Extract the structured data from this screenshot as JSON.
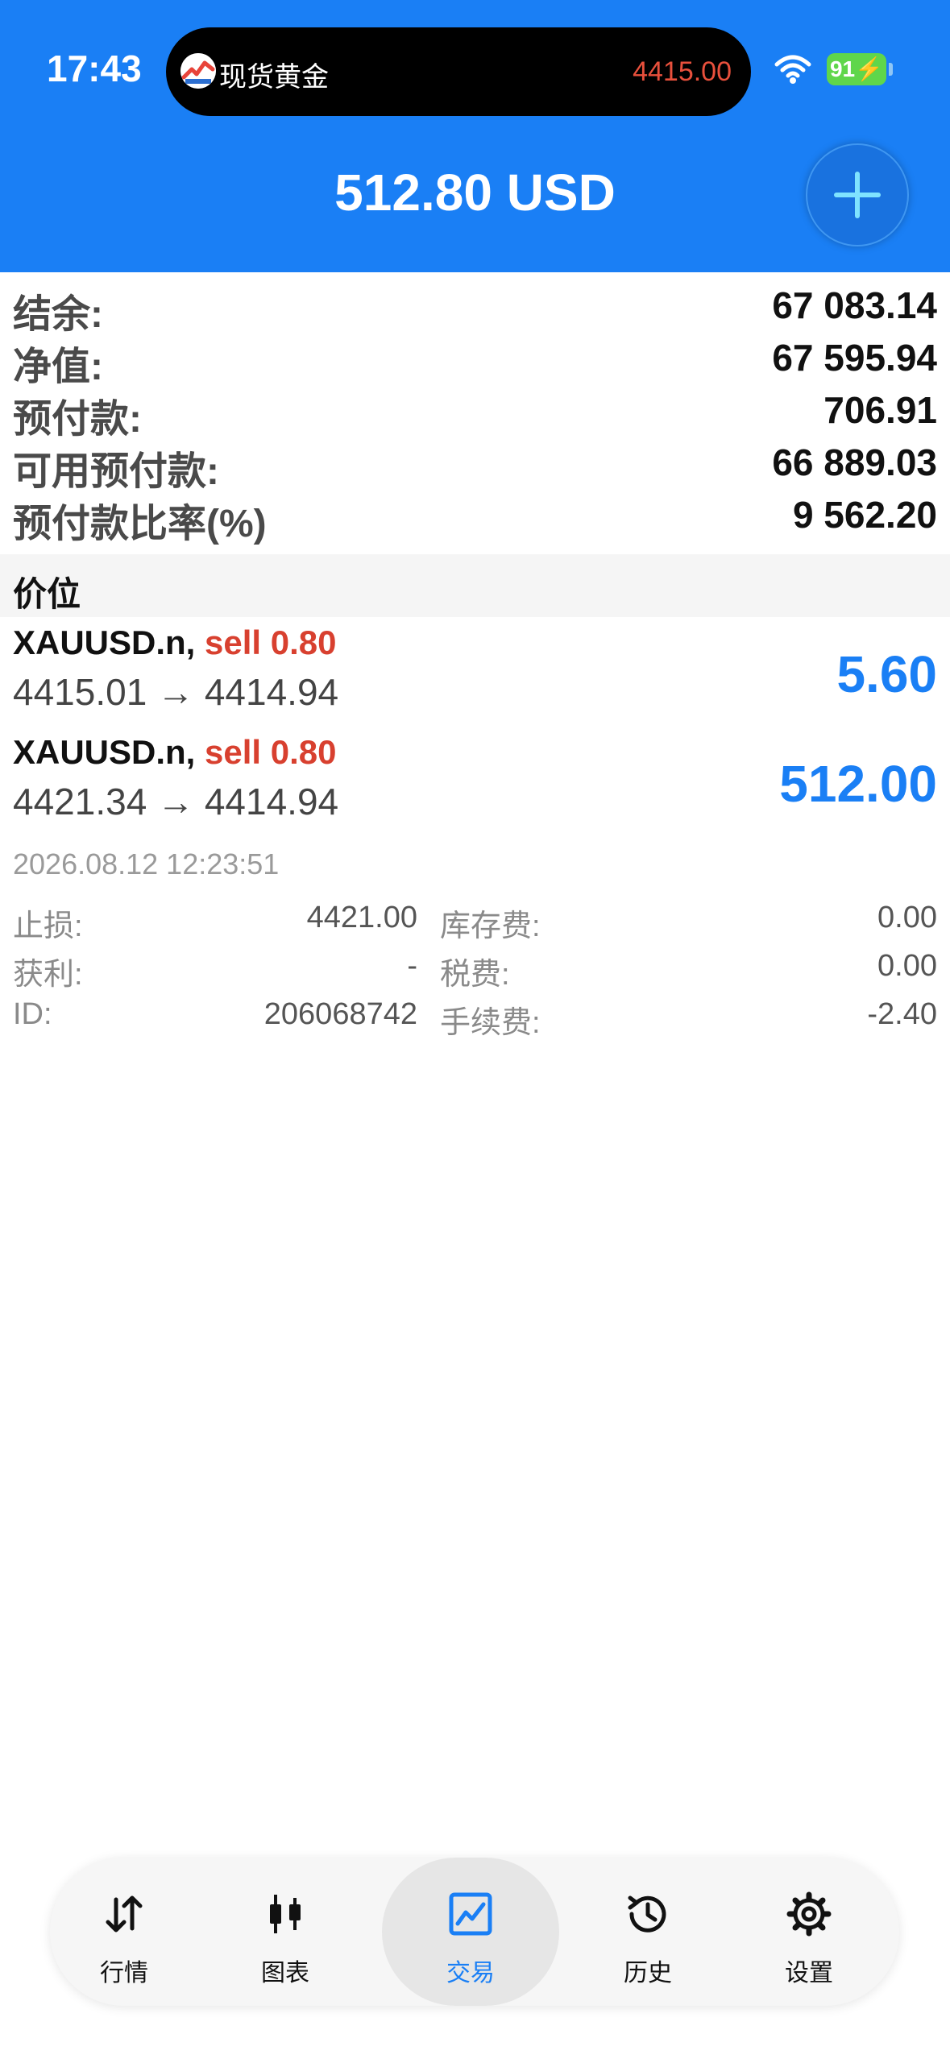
{
  "status_bar": {
    "time": "17:43",
    "live_activity": {
      "title": "现货黄金",
      "price": "4415.00"
    },
    "battery": "91"
  },
  "header": {
    "profit": "512.80 USD"
  },
  "summary": [
    {
      "label": "结余:",
      "value": "67 083.14"
    },
    {
      "label": "净值:",
      "value": "67 595.94"
    },
    {
      "label": "预付款:",
      "value": "706.91"
    },
    {
      "label": "可用预付款:",
      "value": "66 889.03"
    },
    {
      "label": "预付款比率(%)",
      "value": "9 562.20"
    }
  ],
  "positions_section": {
    "title": "价位"
  },
  "positions": [
    {
      "symbol": "XAUUSD.n,",
      "side": "sell 0.80",
      "prices": "4415.01 → 4414.94",
      "profit": "5.60"
    },
    {
      "symbol": "XAUUSD.n,",
      "side": "sell 0.80",
      "prices": "4421.34 → 4414.94",
      "profit": "512.00"
    }
  ],
  "position_details": {
    "timestamp": "2026.08.12 12:23:51",
    "rows": [
      {
        "left_label": "止损:",
        "left_value": "4421.00",
        "right_label": "库存费:",
        "right_value": "0.00"
      },
      {
        "left_label": "获利:",
        "left_value": "-",
        "right_label": "税费:",
        "right_value": "0.00"
      },
      {
        "left_label": "ID:",
        "left_value": "206068742",
        "right_label": "手续费:",
        "right_value": "-2.40"
      }
    ]
  },
  "tabs": [
    {
      "label": "行情",
      "icon": "quotes-arrows-icon",
      "active": false
    },
    {
      "label": "图表",
      "icon": "candlestick-chart-icon",
      "active": false
    },
    {
      "label": "交易",
      "icon": "trade-chart-icon",
      "active": true
    },
    {
      "label": "历史",
      "icon": "history-clock-icon",
      "active": false
    },
    {
      "label": "设置",
      "icon": "settings-gear-icon",
      "active": false
    }
  ],
  "colors": {
    "brand_blue": "#1a7ff5",
    "sell_red": "#d8402f",
    "island_price_red": "#e8503c",
    "battery_green": "#5fd64b"
  }
}
